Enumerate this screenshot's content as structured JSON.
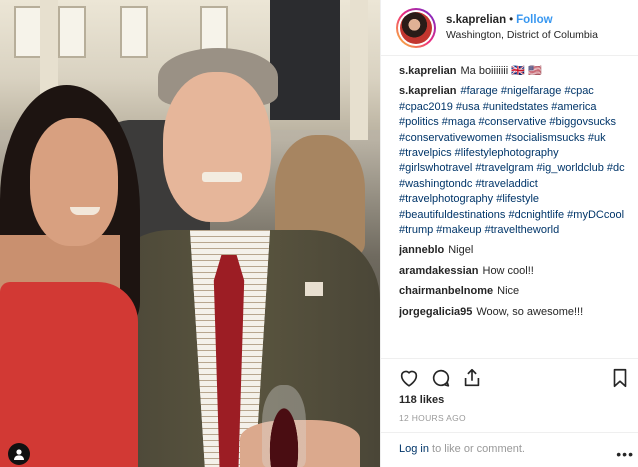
{
  "post": {
    "username": "s.kaprelian",
    "separator": "•",
    "follow_label": "Follow",
    "location": "Washington, District of Columbia"
  },
  "comments": [
    {
      "user": "s.kaprelian",
      "text": "Ma boiiiiiii 🇬🇧 🇺🇸",
      "is_tags": false
    },
    {
      "user": "s.kaprelian",
      "text": "#farage #nigelfarage #cpac #cpac2019 #usa #unitedstates #america #politics #maga #conservative #biggovsucks #conservativewomen #socialismsucks #uk #travelpics #lifestylephotography #girlswhotravel #travelgram #ig_worldclub #dc #washingtondc #traveladdict #travelphotography #lifestyle #beautifuldestinations #dcnightlife #myDCcool #trump #makeup #traveltheworld",
      "is_tags": true
    },
    {
      "user": "janneblo",
      "text": "Nigel",
      "is_tags": false
    },
    {
      "user": "aramdakessian",
      "text": "How cool!!",
      "is_tags": false
    },
    {
      "user": "chairmanbelnome",
      "text": "Nice",
      "is_tags": false
    },
    {
      "user": "jorgegalicia95",
      "text": "Woow, so awesome!!!",
      "is_tags": false
    }
  ],
  "actions": {
    "icons": [
      "heart-icon",
      "comment-icon",
      "share-icon",
      "bookmark-icon"
    ]
  },
  "likes": "118 likes",
  "time_ago": "12 hours ago",
  "login": {
    "link": "Log in",
    "suffix": " to like or comment."
  },
  "more_label": "•••",
  "colors": {
    "link": "#003569",
    "follow": "#3897f0",
    "muted": "#999999"
  }
}
